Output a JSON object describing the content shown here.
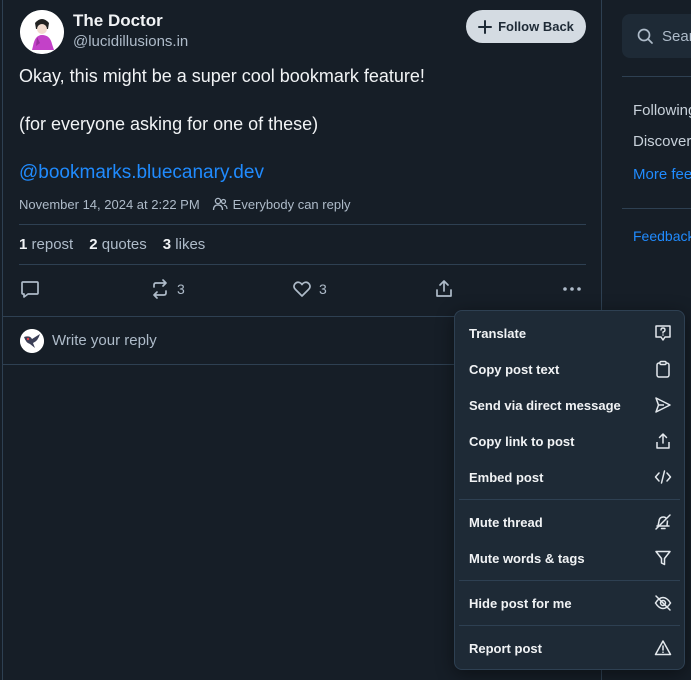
{
  "post": {
    "author_name": "The Doctor",
    "author_handle": "@lucidillusions.in",
    "follow_label": "Follow Back",
    "text_line1": "Okay, this might be a super cool bookmark feature!",
    "text_line2": "(for everyone asking for one of these)",
    "link": "@bookmarks.bluecanary.dev",
    "timestamp": "November 14, 2024 at 2:22 PM",
    "reply_setting": "Everybody can reply",
    "reposts_count": "1",
    "reposts_label": "repost",
    "quotes_count": "2",
    "quotes_label": "quotes",
    "likes_count": "3",
    "likes_label": "likes",
    "action_repost_count": "3",
    "action_like_count": "3"
  },
  "reply": {
    "placeholder": "Write your reply"
  },
  "right": {
    "search_placeholder": "Search",
    "links": [
      "Following",
      "Discover",
      "More feeds"
    ],
    "feedback": "Feedback"
  },
  "menu": {
    "items": [
      "Translate",
      "Copy post text",
      "Send via direct message",
      "Copy link to post",
      "Embed post",
      "Mute thread",
      "Mute words & tags",
      "Hide post for me",
      "Report post"
    ]
  },
  "colors": {
    "accent": "#208bfe",
    "background": "#161e27",
    "menu_bg": "#1e2a36",
    "muted": "#aebbc9"
  }
}
